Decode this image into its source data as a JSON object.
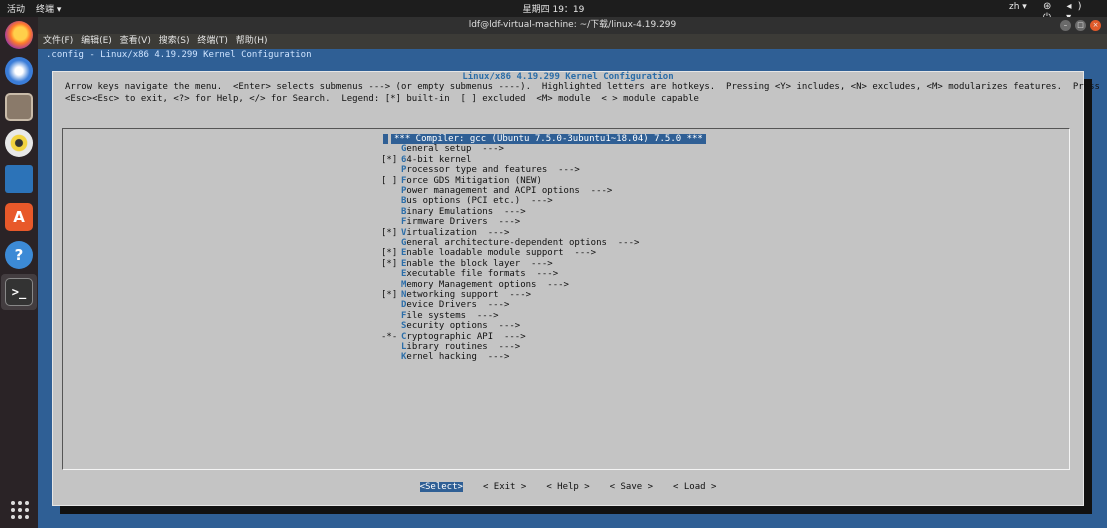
{
  "topbar": {
    "activities": "活动",
    "app_menu": "终端 ▾",
    "clock": "星期四 19：19",
    "lang": "zh ▾",
    "tray": "⊛ ◂) ⏻ ▾"
  },
  "dock": {
    "items": [
      "firefox",
      "thunderbird",
      "files",
      "rhythmbox",
      "libreoffice-writer",
      "ubuntu-software",
      "help",
      "terminal"
    ],
    "terminal_glyph": ">_",
    "software_glyph": "A",
    "help_glyph": "?"
  },
  "window": {
    "title": "ldf@ldf-virtual-machine: ~/下载/linux-4.19.299",
    "menu": [
      "文件(F)",
      "编辑(E)",
      "查看(V)",
      "搜索(S)",
      "终端(T)",
      "帮助(H)"
    ]
  },
  "terminal": {
    "config_line": ".config - Linux/x86 4.19.299 Kernel Configuration",
    "dialog_title": "Linux/x86 4.19.299 Kernel Configuration",
    "help_line1": "Arrow keys navigate the menu.  <Enter> selects submenus ---> (or empty submenus ----).  Highlighted letters are hotkeys.  Pressing <Y> includes, <N> excludes, <M> modularizes features.  Press",
    "help_line2": "<Esc><Esc> to exit, <?> for Help, </> for Search.  Legend: [*] built-in  [ ] excluded  <M> module  < > module capable",
    "menu_items": [
      {
        "mark": "",
        "hk": "",
        "rest": "*** Compiler: gcc (Ubuntu 7.5.0-3ubuntu1~18.04) 7.5.0 ***"
      },
      {
        "mark": "",
        "hk": "G",
        "rest": "eneral setup  --->"
      },
      {
        "mark": "[*]",
        "hk": "6",
        "rest": "4-bit kernel"
      },
      {
        "mark": "",
        "hk": "P",
        "rest": "rocessor type and features  --->"
      },
      {
        "mark": "[ ]",
        "hk": "F",
        "rest": "orce GDS Mitigation (NEW)"
      },
      {
        "mark": "",
        "hk": "P",
        "rest": "ower management and ACPI options  --->"
      },
      {
        "mark": "",
        "hk": "B",
        "rest": "us options (PCI etc.)  --->"
      },
      {
        "mark": "",
        "hk": "B",
        "rest": "inary Emulations  --->"
      },
      {
        "mark": "",
        "hk": "F",
        "rest": "irmware Drivers  --->"
      },
      {
        "mark": "[*]",
        "hk": "V",
        "rest": "irtualization  --->"
      },
      {
        "mark": "",
        "hk": "G",
        "rest": "eneral architecture-dependent options  --->"
      },
      {
        "mark": "[*]",
        "hk": "E",
        "rest": "nable loadable module support  --->"
      },
      {
        "mark": "[*]",
        "hk": "E",
        "rest": "nable the block layer  --->"
      },
      {
        "mark": "",
        "hk": "E",
        "rest": "xecutable file formats  --->"
      },
      {
        "mark": "",
        "hk": "M",
        "rest": "emory Management options  --->"
      },
      {
        "mark": "[*]",
        "hk": "N",
        "rest": "etworking support  --->"
      },
      {
        "mark": "",
        "hk": "D",
        "rest": "evice Drivers  --->"
      },
      {
        "mark": "",
        "hk": "F",
        "rest": "ile systems  --->"
      },
      {
        "mark": "",
        "hk": "S",
        "rest": "ecurity options  --->"
      },
      {
        "mark": "-*-",
        "hk": "C",
        "rest": "ryptographic API  --->"
      },
      {
        "mark": "",
        "hk": "L",
        "rest": "ibrary routines  --->"
      },
      {
        "mark": "",
        "hk": "K",
        "rest": "ernel hacking  --->"
      }
    ],
    "buttons": [
      "<Select>",
      "< Exit >",
      "< Help >",
      "< Save >",
      "< Load >"
    ]
  }
}
